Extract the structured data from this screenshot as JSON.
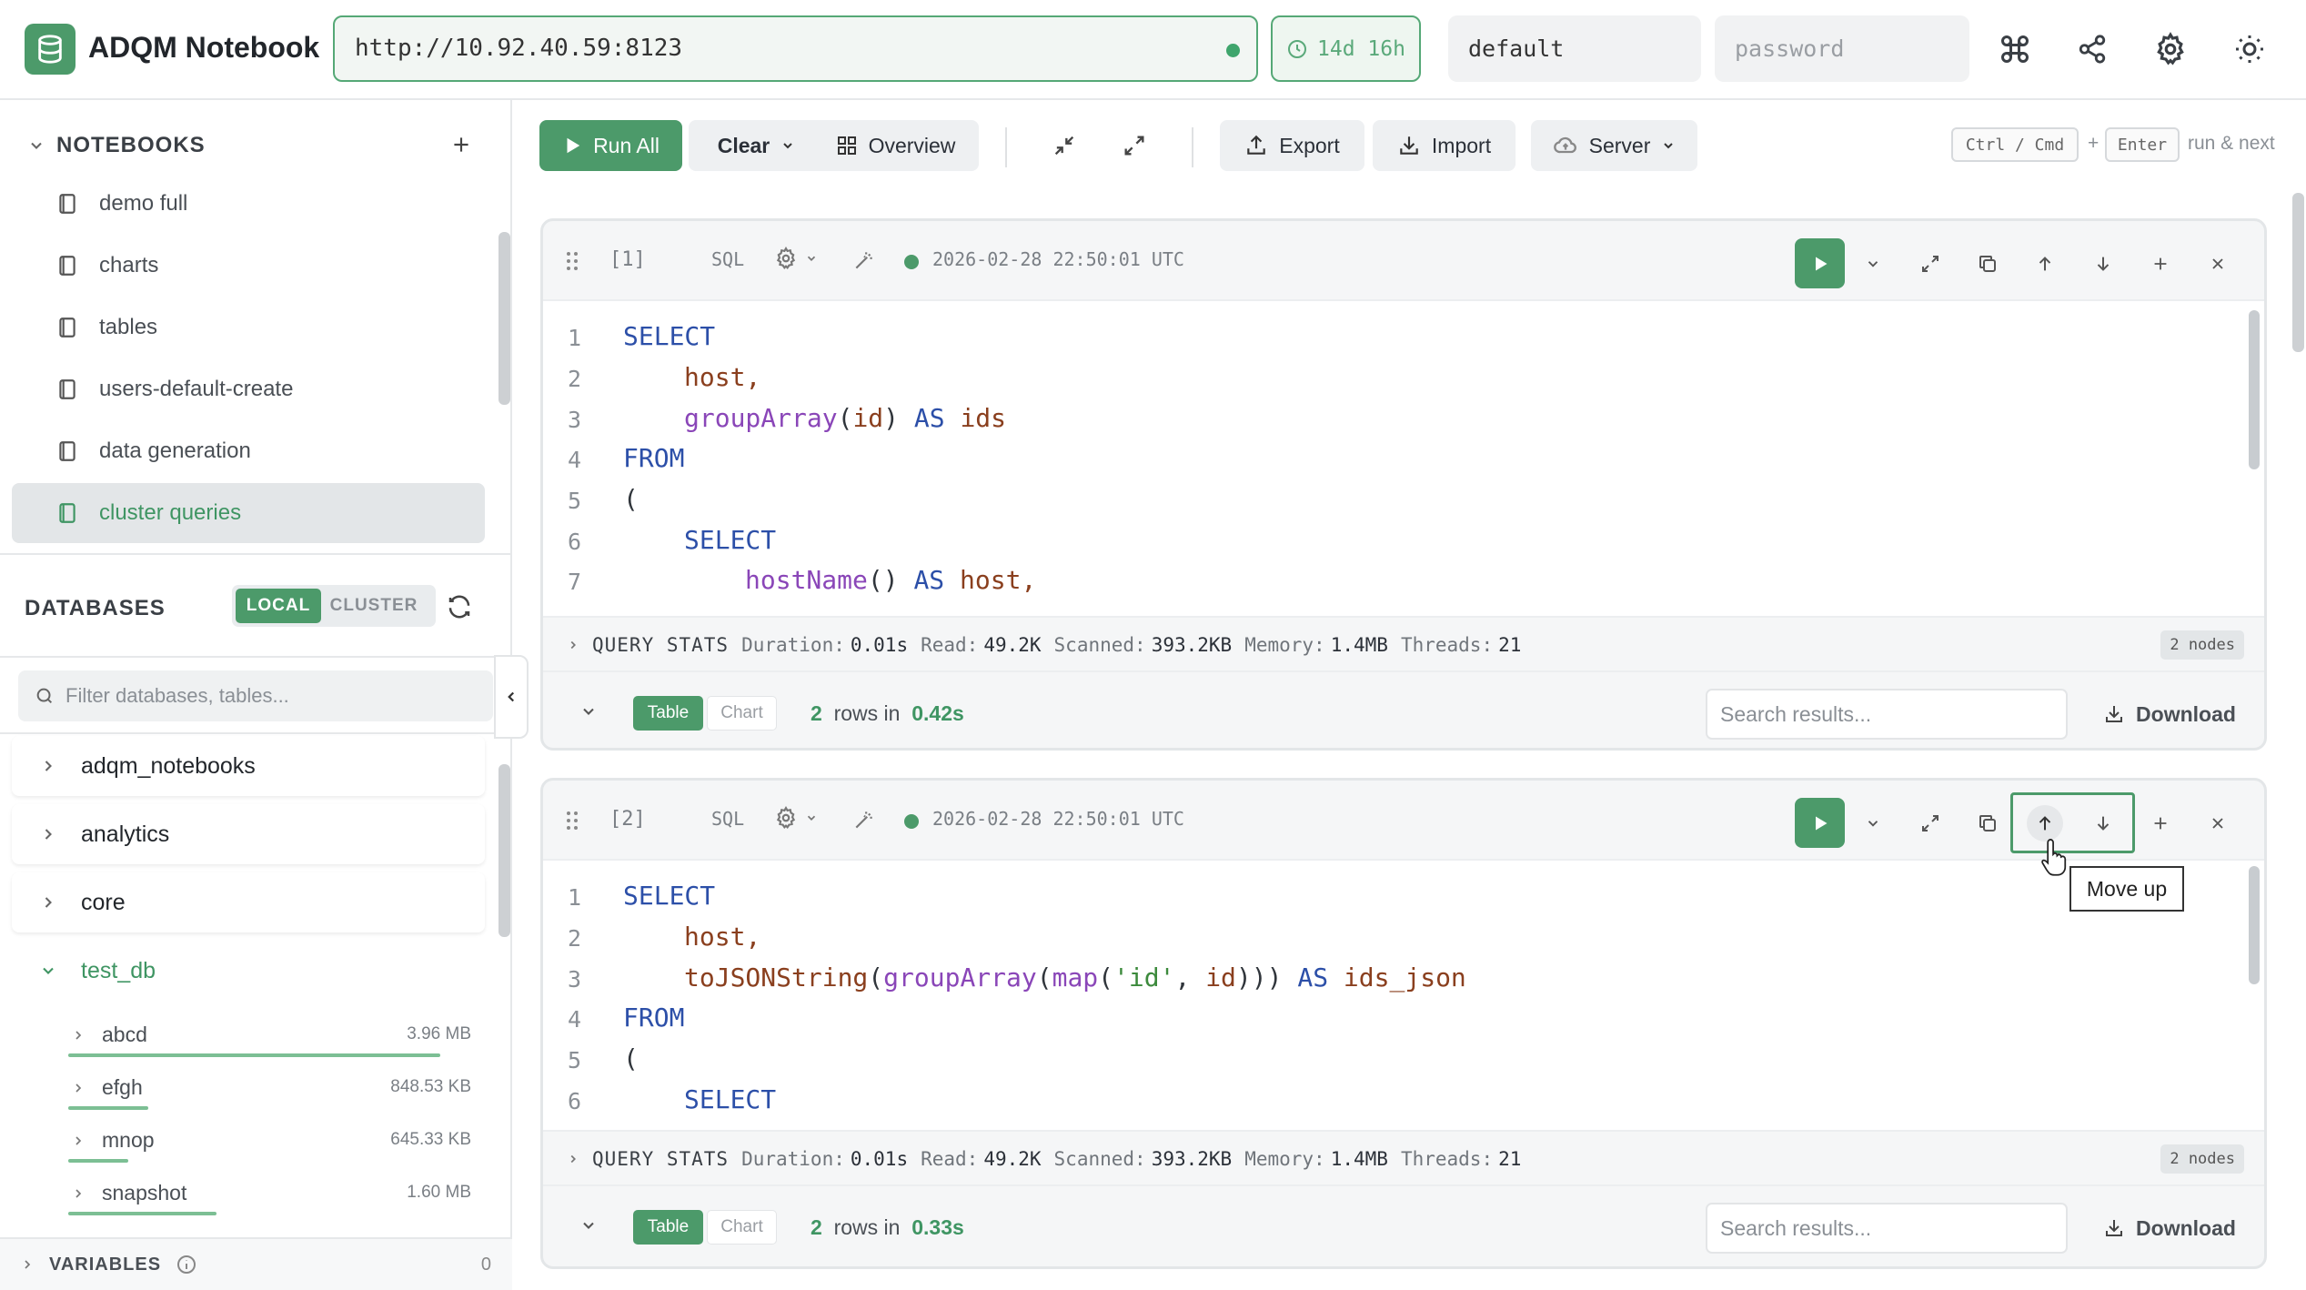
{
  "header": {
    "app_title": "ADQM Notebook",
    "url": "http://10.92.40.59:8123",
    "session_ttl": "14d 16h",
    "username": "default",
    "password_placeholder": "password"
  },
  "sidebar": {
    "notebooks_title": "NOTEBOOKS",
    "notebooks": [
      {
        "label": "demo full"
      },
      {
        "label": "charts"
      },
      {
        "label": "tables"
      },
      {
        "label": "users-default-create"
      },
      {
        "label": "data generation"
      },
      {
        "label": "cluster queries",
        "active": true
      }
    ],
    "databases_title": "DATABASES",
    "scope_local": "LOCAL",
    "scope_cluster": "CLUSTER",
    "filter_placeholder": "Filter databases, tables...",
    "databases": [
      {
        "name": "adqm_notebooks"
      },
      {
        "name": "analytics"
      },
      {
        "name": "core"
      },
      {
        "name": "test_db",
        "expanded": true
      }
    ],
    "tables": [
      {
        "name": "abcd",
        "size": "3.96 MB",
        "fill": 0.93
      },
      {
        "name": "efgh",
        "size": "848.53 KB",
        "fill": 0.2
      },
      {
        "name": "mnop",
        "size": "645.33 KB",
        "fill": 0.15
      },
      {
        "name": "snapshot",
        "size": "1.60 MB",
        "fill": 0.37
      }
    ],
    "variables_title": "VARIABLES",
    "variables_count": "0"
  },
  "toolbar": {
    "run_all": "Run All",
    "clear": "Clear",
    "overview": "Overview",
    "export": "Export",
    "import": "Import",
    "server": "Server",
    "kbd_mod": "Ctrl / Cmd",
    "kbd_plus": "+",
    "kbd_enter": "Enter",
    "kbd_hint": "run & next"
  },
  "cells": [
    {
      "index": "[1]",
      "lang": "SQL",
      "timestamp": "2026-02-28 22:50:01 UTC",
      "line_numbers": [
        "1",
        "2",
        "3",
        "4",
        "5",
        "6",
        "7"
      ],
      "stats": {
        "label": "QUERY STATS",
        "duration_label": "Duration:",
        "duration": "0.01s",
        "read_label": "Read:",
        "read": "49.2K",
        "scanned_label": "Scanned:",
        "scanned": "393.2KB",
        "memory_label": "Memory:",
        "memory": "1.4MB",
        "threads_label": "Threads:",
        "threads": "21",
        "nodes": "2 nodes"
      },
      "view_table": "Table",
      "view_chart": "Chart",
      "row_count": "2",
      "rows_in": "rows in",
      "elapsed": "0.42s",
      "search_placeholder": "Search results...",
      "download": "Download"
    },
    {
      "index": "[2]",
      "lang": "SQL",
      "timestamp": "2026-02-28 22:50:01 UTC",
      "line_numbers": [
        "1",
        "2",
        "3",
        "4",
        "5",
        "6"
      ],
      "stats": {
        "label": "QUERY STATS",
        "duration_label": "Duration:",
        "duration": "0.01s",
        "read_label": "Read:",
        "read": "49.2K",
        "scanned_label": "Scanned:",
        "scanned": "393.2KB",
        "memory_label": "Memory:",
        "memory": "1.4MB",
        "threads_label": "Threads:",
        "threads": "21",
        "nodes": "2 nodes"
      },
      "view_table": "Table",
      "view_chart": "Chart",
      "row_count": "2",
      "rows_in": "rows in",
      "elapsed": "0.33s",
      "search_placeholder": "Search results...",
      "download": "Download"
    }
  ],
  "code": {
    "select": "SELECT",
    "from": "FROM",
    "as": "AS",
    "host": "host",
    "comma": ",",
    "open_paren": "(",
    "close_paren": ")",
    "group_array": "groupArray",
    "id": "id",
    "ids": "ids",
    "host_name": "hostName",
    "empty_parens": "()",
    "to_json_string": "toJSONString",
    "map": "map",
    "id_string": "'id'",
    "close_three": ")))",
    "ids_json": "ids_json"
  },
  "tooltip": "Move up",
  "colors": {
    "accent": "#4c9a6a",
    "accent_text": "#3f9563",
    "keyword": "#2c4fa8",
    "identifier": "#8a3f1e",
    "function": "#8a46b8",
    "string": "#3c8a3c"
  },
  "icons": [
    "database-icon",
    "clock-icon",
    "command-icon",
    "share-icon",
    "gear-icon",
    "sun-icon",
    "notebook-icon",
    "plus-icon",
    "refresh-icon",
    "search-icon",
    "chevron-left-icon",
    "info-icon",
    "play-icon",
    "chevron-down-icon",
    "grid-icon",
    "collapse-icon",
    "expand-icon",
    "upload-icon",
    "download-icon",
    "cloud-icon",
    "drag-handle-icon",
    "magic-wand-icon",
    "copy-icon",
    "arrow-up-icon",
    "arrow-down-icon",
    "close-icon",
    "cursor-icon"
  ]
}
